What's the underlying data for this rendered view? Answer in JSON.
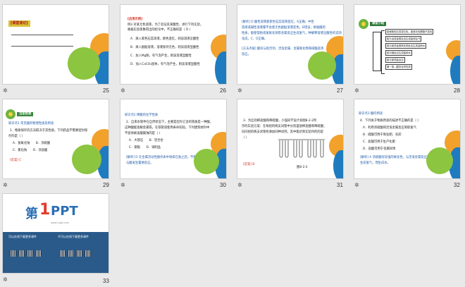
{
  "slides": [
    {
      "number": "25",
      "title": "[课堂速记]"
    },
    {
      "number": "26",
      "header": "[应用示例]",
      "lines": [
        "例3 对某无色溶液，为了验证其某酸性，进行下列实验，",
        "根据实验现象得出的结论中，不正确的是（ D ）",
        "A．滴入紫色石蕊溶液，颜色变红，则该溶液呈酸性",
        "B．滴入酚酞溶液，溶液保持无色，则该溶液显酸性",
        "C．加入Mg粉，有气泡产生，则该溶液显酸性",
        "D．加入CaCO₃固体，有气泡产生，则该溶液显酸性"
      ]
    },
    {
      "number": "27",
      "lines": [
        "[解析] D 酸性溶液使紫色石蕊溶液变红，A正确；中性",
        "溶液或碱性溶液都不会使无色酚酞溶液变色，B错误；根据酸的",
        "性质，能使镁粉或氢氧化铜等金属反应生成氢气，种解释溶液呈酸性的选项",
        "化成，C、D正确。",
        "[方法点拨] 酸有与指示剂、活泼金属、金属氧化物和碳酸盐等",
        "反应。"
      ]
    },
    {
      "number": "28",
      "summary_title": "课堂小结",
      "summary_lines": [
        "能使紫色石蕊变红色，能使无色酚酞不变色",
        "能与活泼金属反应生成盐和氢气",
        "能与某些金属氧化物反应生成盐和水",
        "能与碱反应生成盐和水",
        "能与某些盐反应",
        "第一类—酸的化学性质"
      ]
    },
    {
      "number": "29",
      "section": "当堂检测",
      "lines": [
        "知识点1 常见酸的物理性质及用途",
        "1．物质保存的方法取决于其性质，下列药品不需要密封保",
        "存的是（ ）",
        "A．氢氧化钠　　B．浓硫酸",
        "C．氯化钠　　D．浓盐酸",
        "[答案] C"
      ]
    },
    {
      "number": "30",
      "lines": [
        "知识点2 稀酸的化学性质",
        "2．自来水管件在自然状态下，主要是因为它含的铁质是一种酸，",
        "这种酸能溶解金属铁，在铁管道使用寿命较短。下列建筑材料中",
        "不容易被该酸腐蚀的是（ ）",
        "A．大理石　　B．铝合金",
        "C．钢筋　　D．铜制品",
        "[解析] D 在金属活动性顺序表中铜排在氢之后，不能",
        "与酸发生置换反应。"
      ]
    },
    {
      "number": "31",
      "lines": [
        "3．为区别稀盐酸和稀硫酸，小强同学设计如图8-2-2所",
        "示的实验方案：在每组的两支试管中分别盛放稀盐酸和稀硫酸；",
        "向同组的两支试管各滴加同种试剂。其中能达到实验目的的是",
        "（ ）"
      ],
      "answer": "[答案] B",
      "figure_caption": "图8-2-2"
    },
    {
      "number": "32",
      "lines": [
        "知识点3 酸的用途",
        "4．下列关于物质用途的描述不正确的是（ ）",
        "A．利用浓硫酸和活泼金属反应制取氢气",
        "B．硫酸可用于制化肥、农药",
        "C．盐酸可用于生产化肥",
        "D．盐酸可用于金属除锈",
        "[解析] A 浓硫酸有较强的氧化性，与活泼金属反应不能",
        "生成氢气，而生成水。"
      ]
    },
    {
      "number": "33",
      "logo_first": "第",
      "logo_one": "1",
      "logo_ppt": "PPT",
      "logo_url": "www.1ppt.com",
      "qr_left_title": "可以在线下载更多课件",
      "qr_right_title": "不可以在线下载更多课件"
    }
  ],
  "colors": {
    "green": "#8cc540",
    "orange": "#f2a12b",
    "blue": "#1f7bbf",
    "title_red": "#c62a1c"
  }
}
